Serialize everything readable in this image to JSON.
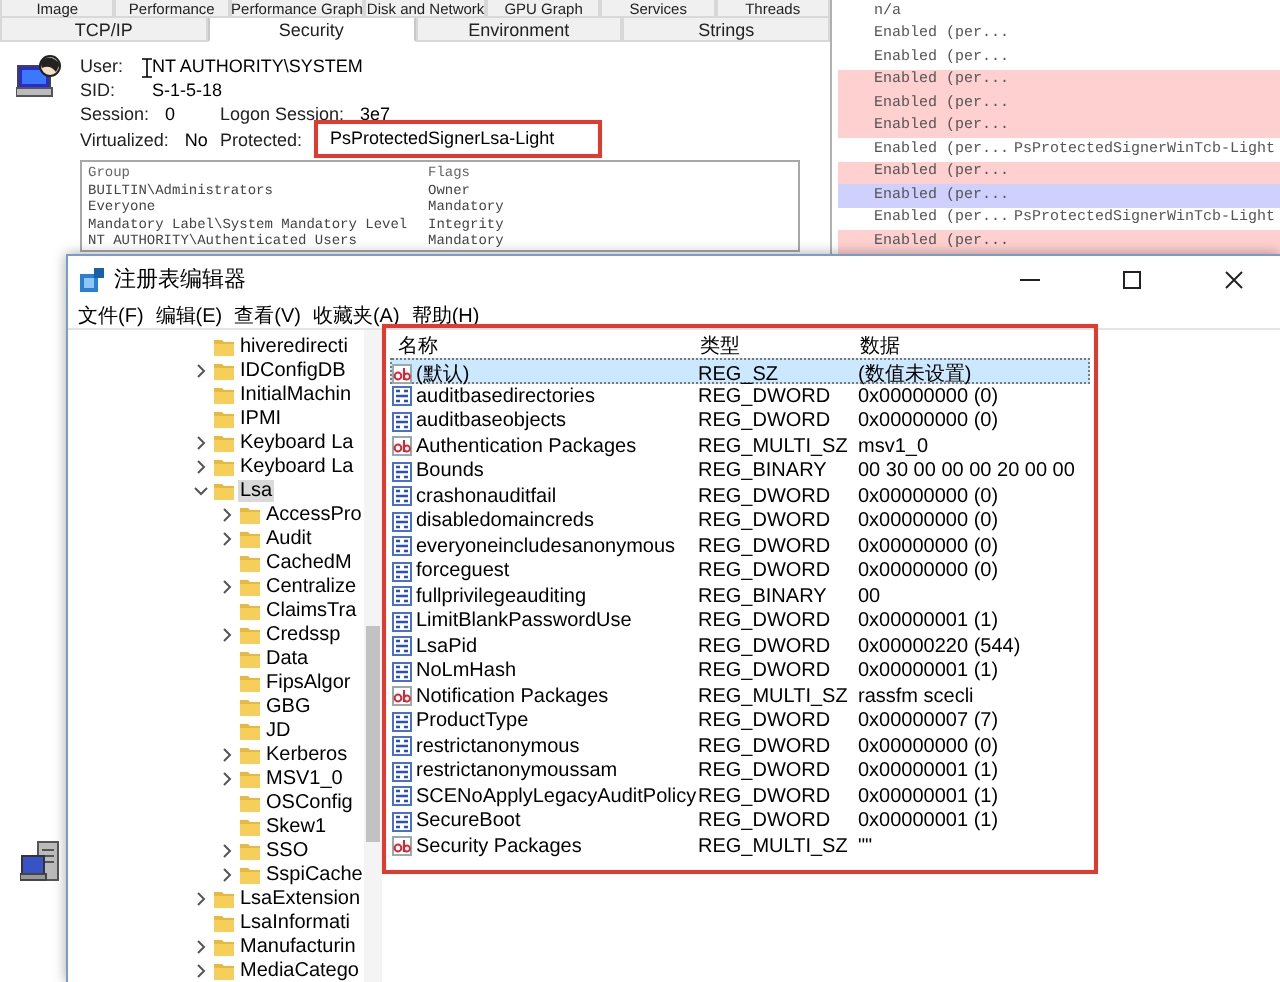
{
  "properties_window": {
    "tab_rows": [
      [
        {
          "label": "Image",
          "selected": false
        },
        {
          "label": "Performance",
          "selected": false
        },
        {
          "label": "Performance Graph",
          "selected": false
        },
        {
          "label": "Disk and Network",
          "selected": false
        },
        {
          "label": "GPU Graph",
          "selected": false
        },
        {
          "label": "Services",
          "selected": false
        },
        {
          "label": "Threads",
          "selected": false
        }
      ],
      [
        {
          "label": "TCP/IP",
          "selected": false
        },
        {
          "label": "Security",
          "selected": true
        },
        {
          "label": "Environment",
          "selected": false
        },
        {
          "label": "Strings",
          "selected": false
        }
      ]
    ],
    "fields": [
      [
        {
          "label": "User:",
          "value": "NT AUTHORITY\\SYSTEM",
          "highlighted": false
        }
      ],
      [
        {
          "label": "SID:",
          "value": "S-1-5-18",
          "highlighted": false
        }
      ],
      [
        {
          "label": "Session:",
          "value": "0",
          "highlighted": false
        },
        {
          "label": "Logon Session:",
          "value": "3e7",
          "highlighted": false
        }
      ],
      [
        {
          "label": "Virtualized:",
          "value": "No",
          "highlighted": false
        },
        {
          "label": "Protected:",
          "value": "PsProtectedSignerLsa-Light",
          "highlighted": true
        }
      ]
    ],
    "groups": {
      "columns": [
        "Group",
        "Flags"
      ],
      "rows": [
        [
          "BUILTIN\\Administrators",
          "Owner"
        ],
        [
          "Everyone",
          "Mandatory"
        ],
        [
          "Mandatory Label\\System Mandatory Level",
          "Integrity"
        ],
        [
          "NT AUTHORITY\\Authenticated Users",
          "Mandatory"
        ]
      ]
    }
  },
  "privileges": [
    {
      "status": "n/a",
      "color": "#ffffff"
    },
    {
      "status": "Enabled (per...",
      "color": "#ffffff"
    },
    {
      "status": "Enabled (per...",
      "color": "#ffffff"
    },
    {
      "status": "Enabled (per...",
      "color": "#ffd0d0"
    },
    {
      "status": "Enabled (per...",
      "color": "#ffd0d0"
    },
    {
      "status": "Enabled (per...",
      "color": "#ffd0d0"
    },
    {
      "status": "Enabled (per...",
      "protection": "PsProtectedSignerWinTcb-Light",
      "color": "#ffffff"
    },
    {
      "status": "Enabled (per...",
      "color": "#ffd0d0"
    },
    {
      "status": "Enabled (per...",
      "color": "#d0d0ff"
    },
    {
      "status": "Enabled (per...",
      "protection": "PsProtectedSignerWinTcb-Light",
      "color": "#ffffff"
    },
    {
      "status": "Enabled (per...",
      "color": "#ffd0d0"
    }
  ],
  "registry_editor": {
    "title": "注册表编辑器",
    "menu": [
      "文件(F)",
      "编辑(E)",
      "查看(V)",
      "收藏夹(A)",
      "帮助(H)"
    ],
    "tree": [
      {
        "label": "hiveredirecti",
        "expandable": false,
        "selected": false
      },
      {
        "label": "IDConfigDB",
        "expandable": true,
        "expanded": false,
        "selected": false
      },
      {
        "label": "InitialMachin",
        "expandable": false,
        "selected": false
      },
      {
        "label": "IPMI",
        "expandable": false,
        "selected": false
      },
      {
        "label": "Keyboard La",
        "expandable": true,
        "expanded": false,
        "selected": false
      },
      {
        "label": "Keyboard La",
        "expandable": true,
        "expanded": false,
        "selected": false
      },
      {
        "label": "Lsa",
        "expandable": true,
        "expanded": true,
        "selected": true,
        "children": [
          {
            "label": "AccessPro",
            "expandable": true,
            "expanded": false,
            "selected": false
          },
          {
            "label": "Audit",
            "expandable": true,
            "expanded": false,
            "selected": false
          },
          {
            "label": "CachedM",
            "expandable": false,
            "selected": false
          },
          {
            "label": "Centralize",
            "expandable": true,
            "expanded": false,
            "selected": false
          },
          {
            "label": "ClaimsTra",
            "expandable": false,
            "selected": false
          },
          {
            "label": "Credssp",
            "expandable": true,
            "expanded": false,
            "selected": false
          },
          {
            "label": "Data",
            "expandable": false,
            "selected": false
          },
          {
            "label": "FipsAlgor",
            "expandable": false,
            "selected": false
          },
          {
            "label": "GBG",
            "expandable": false,
            "selected": false
          },
          {
            "label": "JD",
            "expandable": false,
            "selected": false
          },
          {
            "label": "Kerberos",
            "expandable": true,
            "expanded": false,
            "selected": false
          },
          {
            "label": "MSV1_0",
            "expandable": true,
            "expanded": false,
            "selected": false
          },
          {
            "label": "OSConfig",
            "expandable": false,
            "selected": false
          },
          {
            "label": "Skew1",
            "expandable": false,
            "selected": false
          },
          {
            "label": "SSO",
            "expandable": true,
            "expanded": false,
            "selected": false
          },
          {
            "label": "SspiCache",
            "expandable": true,
            "expanded": false,
            "selected": false
          }
        ]
      },
      {
        "label": "LsaExtension",
        "expandable": true,
        "expanded": false,
        "selected": false
      },
      {
        "label": "LsaInformati",
        "expandable": false,
        "selected": false
      },
      {
        "label": "Manufacturin",
        "expandable": true,
        "expanded": false,
        "selected": false
      },
      {
        "label": "MediaCatego",
        "expandable": true,
        "expanded": false,
        "selected": false
      }
    ],
    "columns": [
      "名称",
      "类型",
      "数据"
    ],
    "highlighted": true,
    "rows": [
      {
        "kind": "string",
        "name": "(默认)",
        "type": "REG_SZ",
        "data": "(数值未设置)",
        "selected": true
      },
      {
        "kind": "binary",
        "name": "auditbasedirectories",
        "type": "REG_DWORD",
        "data": "0x00000000 (0)",
        "selected": false
      },
      {
        "kind": "binary",
        "name": "auditbaseobjects",
        "type": "REG_DWORD",
        "data": "0x00000000 (0)",
        "selected": false
      },
      {
        "kind": "string",
        "name": "Authentication Packages",
        "type": "REG_MULTI_SZ",
        "data": "msv1_0",
        "selected": false
      },
      {
        "kind": "binary",
        "name": "Bounds",
        "type": "REG_BINARY",
        "data": "00 30 00 00 00 20 00 00",
        "selected": false
      },
      {
        "kind": "binary",
        "name": "crashonauditfail",
        "type": "REG_DWORD",
        "data": "0x00000000 (0)",
        "selected": false
      },
      {
        "kind": "binary",
        "name": "disabledomaincreds",
        "type": "REG_DWORD",
        "data": "0x00000000 (0)",
        "selected": false
      },
      {
        "kind": "binary",
        "name": "everyoneincludesanonymous",
        "type": "REG_DWORD",
        "data": "0x00000000 (0)",
        "selected": false
      },
      {
        "kind": "binary",
        "name": "forceguest",
        "type": "REG_DWORD",
        "data": "0x00000000 (0)",
        "selected": false
      },
      {
        "kind": "binary",
        "name": "fullprivilegeauditing",
        "type": "REG_BINARY",
        "data": "00",
        "selected": false
      },
      {
        "kind": "binary",
        "name": "LimitBlankPasswordUse",
        "type": "REG_DWORD",
        "data": "0x00000001 (1)",
        "selected": false
      },
      {
        "kind": "binary",
        "name": "LsaPid",
        "type": "REG_DWORD",
        "data": "0x00000220 (544)",
        "selected": false
      },
      {
        "kind": "binary",
        "name": "NoLmHash",
        "type": "REG_DWORD",
        "data": "0x00000001 (1)",
        "selected": false
      },
      {
        "kind": "string",
        "name": "Notification Packages",
        "type": "REG_MULTI_SZ",
        "data": "rassfm scecli",
        "selected": false
      },
      {
        "kind": "binary",
        "name": "ProductType",
        "type": "REG_DWORD",
        "data": "0x00000007 (7)",
        "selected": false
      },
      {
        "kind": "binary",
        "name": "restrictanonymous",
        "type": "REG_DWORD",
        "data": "0x00000000 (0)",
        "selected": false
      },
      {
        "kind": "binary",
        "name": "restrictanonymoussam",
        "type": "REG_DWORD",
        "data": "0x00000001 (1)",
        "selected": false
      },
      {
        "kind": "binary",
        "name": "SCENoApplyLegacyAuditPolicy",
        "type": "REG_DWORD",
        "data": "0x00000001 (1)",
        "selected": false
      },
      {
        "kind": "binary",
        "name": "SecureBoot",
        "type": "REG_DWORD",
        "data": "0x00000001 (1)",
        "selected": false
      },
      {
        "kind": "string",
        "name": "Security Packages",
        "type": "REG_MULTI_SZ",
        "data": "\"\"",
        "selected": false
      }
    ]
  }
}
